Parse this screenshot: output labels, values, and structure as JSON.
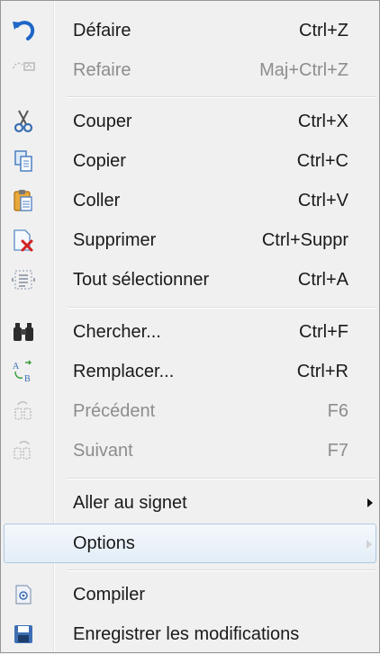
{
  "menu": {
    "undo": {
      "label": "Défaire",
      "shortcut": "Ctrl+Z",
      "icon": "undo-icon"
    },
    "redo": {
      "label": "Refaire",
      "shortcut": "Maj+Ctrl+Z",
      "icon": "redo-icon",
      "disabled": true
    },
    "cut": {
      "label": "Couper",
      "shortcut": "Ctrl+X",
      "icon": "scissors-icon"
    },
    "copy": {
      "label": "Copier",
      "shortcut": "Ctrl+C",
      "icon": "copy-icon"
    },
    "paste": {
      "label": "Coller",
      "shortcut": "Ctrl+V",
      "icon": "clipboard-icon"
    },
    "delete": {
      "label": "Supprimer",
      "shortcut": "Ctrl+Suppr",
      "icon": "delete-document-icon"
    },
    "select_all": {
      "label": "Tout sélectionner",
      "shortcut": "Ctrl+A",
      "icon": "select-all-icon"
    },
    "find": {
      "label": "Chercher...",
      "shortcut": "Ctrl+F",
      "icon": "binoculars-icon"
    },
    "replace": {
      "label": "Remplacer...",
      "shortcut": "Ctrl+R",
      "icon": "replace-icon"
    },
    "previous": {
      "label": "Précédent",
      "shortcut": "F6",
      "icon": "find-previous-icon",
      "disabled": true
    },
    "next": {
      "label": "Suivant",
      "shortcut": "F7",
      "icon": "find-next-icon",
      "disabled": true
    },
    "goto_bookmark": {
      "label": "Aller au signet",
      "has_submenu": true
    },
    "options": {
      "label": "Options",
      "has_submenu": true,
      "highlighted": true
    },
    "compile": {
      "label": "Compiler",
      "icon": "compile-icon"
    },
    "save_changes": {
      "label": "Enregistrer les modifications",
      "icon": "save-icon"
    }
  },
  "colors": {
    "background": "#f0f0f0",
    "text": "#1a1a1a",
    "disabled_text": "#8d8d8d",
    "highlight_border": "#b0c8e0"
  }
}
